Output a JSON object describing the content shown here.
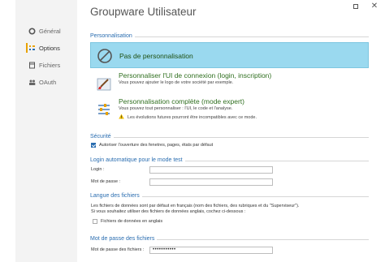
{
  "window": {
    "title": "Groupware Utilisateur"
  },
  "sidebar": {
    "items": [
      {
        "label": "Général",
        "icon": "circle-icon"
      },
      {
        "label": "Options",
        "icon": "options-icon"
      },
      {
        "label": "Fichiers",
        "icon": "file-icon"
      },
      {
        "label": "OAuth",
        "icon": "users-icon"
      }
    ],
    "active": "Options",
    "accent_color": "#e8a200"
  },
  "sections": {
    "personnalisation": "Personnalisation",
    "securite": "Sécurité",
    "login": "Login automatique pour le mode test",
    "langue": "Langue des fichiers",
    "motdepasse": "Mot de passe des fichiers"
  },
  "options": [
    {
      "title": "Pas de personnalisation",
      "subtitle": "",
      "selected": true
    },
    {
      "title": "Personnaliser l'UI de connexion (login, inscription)",
      "subtitle": "Vous pouvez ajouter le logo de votre société par exemple.",
      "selected": false
    },
    {
      "title": "Personnalisation complète (mode expert)",
      "subtitle": "Vous pouvez tout personnaliser : l'UI, le code et l'analyse.",
      "warning": "Les évolutions futures pourront être incompatibles avec ce mode.",
      "selected": false
    }
  ],
  "security": {
    "checkbox_label": "Autoriser l'ouverture des fenetres, pages, états par défaut",
    "checked": true
  },
  "login": {
    "login_label": "Login :",
    "login_value": "",
    "password_label": "Mot de passe :",
    "password_value": ""
  },
  "langue": {
    "line1": "Les fichiers de données sont par défaut en français (nom des fichiers, des rubriques et du \"Superviseur\").",
    "line2": "Si vous souhaitez utiliser des fichiers de données anglais, cochez ci-dessous :",
    "checkbox_label": "Fichiers de données en anglais",
    "checked": false
  },
  "file_password": {
    "label": "Mot de passe des fichiers :",
    "value": "•••••••••••"
  },
  "colors": {
    "selection": "#9ad9ef",
    "section_title": "#2a6db0",
    "option_title": "#2f6f1f"
  }
}
